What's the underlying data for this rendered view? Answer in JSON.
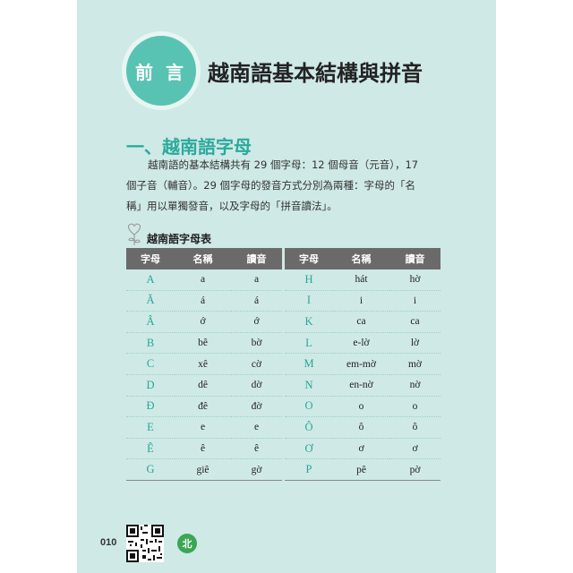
{
  "header": {
    "badge_label": "前言",
    "title": "越南語基本結構與拼音"
  },
  "section": {
    "title": "一、越南語字母",
    "paragraph_line1": "越南語的基本結構共有 29 個字母：12 個母音（元音），17",
    "paragraph_line2": "個子音（輔音）。29 個字母的發音方式分別為兩種：字母的「名",
    "paragraph_line3": "稱」用以單獨發音，以及字母的「拼音讀法」。"
  },
  "table_title": "越南語字母表",
  "tables": {
    "left": {
      "headers": [
        "字母",
        "名稱",
        "讀音"
      ],
      "rows": [
        [
          "A",
          "a",
          "a"
        ],
        [
          "Ă",
          "á",
          "á"
        ],
        [
          "Â",
          "ớ",
          "ớ"
        ],
        [
          "B",
          "bê",
          "bờ"
        ],
        [
          "C",
          "xê",
          "cờ"
        ],
        [
          "D",
          "dê",
          "dờ"
        ],
        [
          "Đ",
          "đê",
          "đờ"
        ],
        [
          "E",
          "e",
          "e"
        ],
        [
          "Ê",
          "ê",
          "ê"
        ],
        [
          "G",
          "giê",
          "gờ"
        ]
      ]
    },
    "right": {
      "headers": [
        "字母",
        "名稱",
        "讀音"
      ],
      "rows": [
        [
          "H",
          "hát",
          "hờ"
        ],
        [
          "I",
          "i",
          "i"
        ],
        [
          "K",
          "ca",
          "ca"
        ],
        [
          "L",
          "e-lờ",
          "lờ"
        ],
        [
          "M",
          "em-mờ",
          "mờ"
        ],
        [
          "N",
          "en-nờ",
          "nờ"
        ],
        [
          "O",
          "o",
          "o"
        ],
        [
          "Ô",
          "ô",
          "ô"
        ],
        [
          "Ơ",
          "ơ",
          "ơ"
        ],
        [
          "P",
          "pê",
          "pờ"
        ]
      ]
    }
  },
  "footer": {
    "page_number": "010",
    "badge": "北"
  },
  "colors": {
    "accent": "#59c3b3",
    "section_title": "#2aaa9c",
    "page_bg": "#cfe9e6",
    "header_row": "#6a6a6a"
  }
}
